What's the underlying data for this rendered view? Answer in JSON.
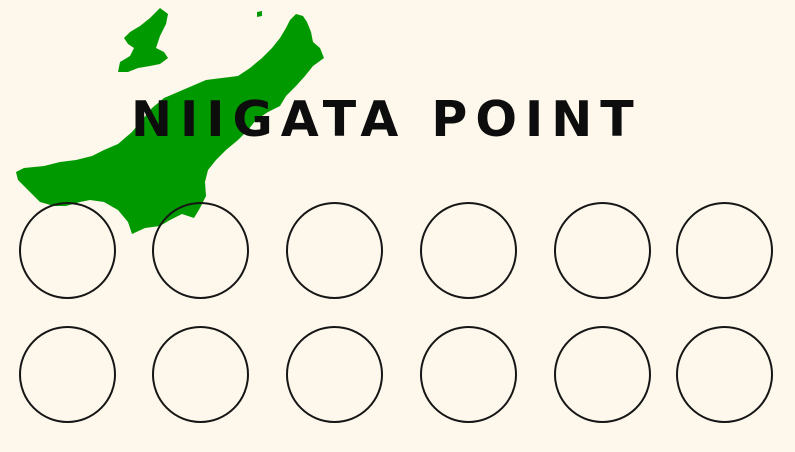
{
  "card": {
    "title": "NIIGATA POINT",
    "map_color": "#009900",
    "background_color": "#fdf8eb",
    "stamp_slots": {
      "rows": 2,
      "columns": 6,
      "filled": 0
    }
  }
}
